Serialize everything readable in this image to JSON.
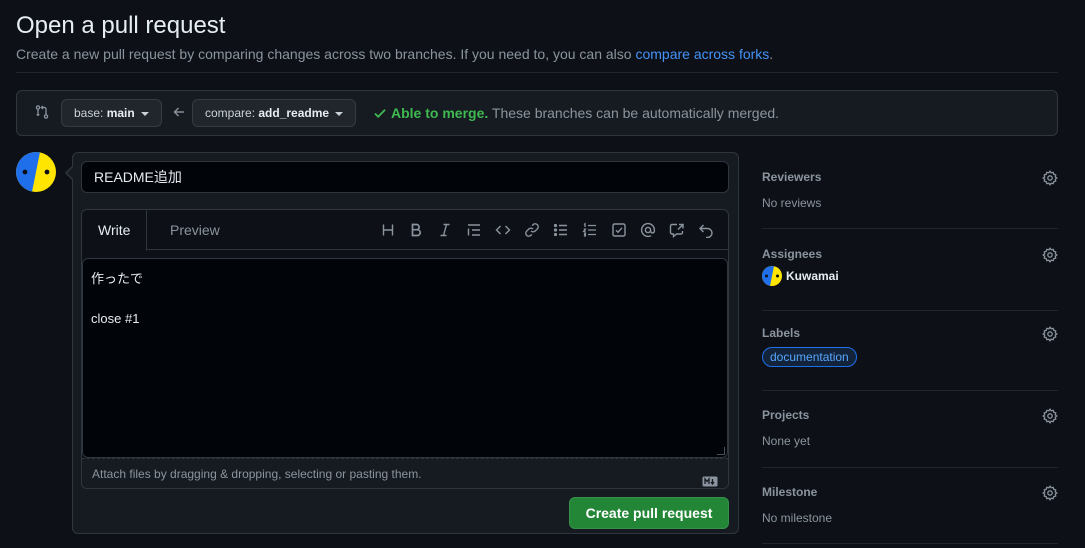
{
  "page": {
    "title": "Open a pull request",
    "subtitle_prefix": "Create a new pull request by comparing changes across two branches. If you need to, you can also ",
    "subtitle_link": "compare across forks",
    "subtitle_suffix": "."
  },
  "range": {
    "base_prefix": "base: ",
    "base_branch": "main",
    "compare_prefix": "compare: ",
    "compare_branch": "add_readme",
    "merge_ok": "Able to merge.",
    "merge_detail": "These branches can be automatically merged."
  },
  "composer": {
    "title_value": "README追加",
    "tabs": {
      "write": "Write",
      "preview": "Preview"
    },
    "toolbar_icons": [
      "heading-icon",
      "bold-icon",
      "italic-icon",
      "quote-icon",
      "code-icon",
      "link-icon",
      "unordered-list-icon",
      "ordered-list-icon",
      "task-list-icon",
      "mention-icon",
      "cross-reference-icon",
      "undo-icon"
    ],
    "body_text": "作ったで\n\nclose #1",
    "attach_hint": "Attach files by dragging & dropping, selecting or pasting them.",
    "submit_label": "Create pull request"
  },
  "sidebar": {
    "reviewers": {
      "heading": "Reviewers",
      "value": "No reviews"
    },
    "assignees": {
      "heading": "Assignees",
      "value": "Kuwamai"
    },
    "labels": {
      "heading": "Labels",
      "value": "documentation"
    },
    "projects": {
      "heading": "Projects",
      "value": "None yet"
    },
    "milestone": {
      "heading": "Milestone",
      "value": "No milestone"
    }
  },
  "colors": {
    "background": "#0d1117",
    "link": "#4493f8",
    "success": "#3fb950",
    "primary_button": "#238636",
    "avatar_blue": "#1f6feb",
    "avatar_yellow": "#ffe500"
  }
}
